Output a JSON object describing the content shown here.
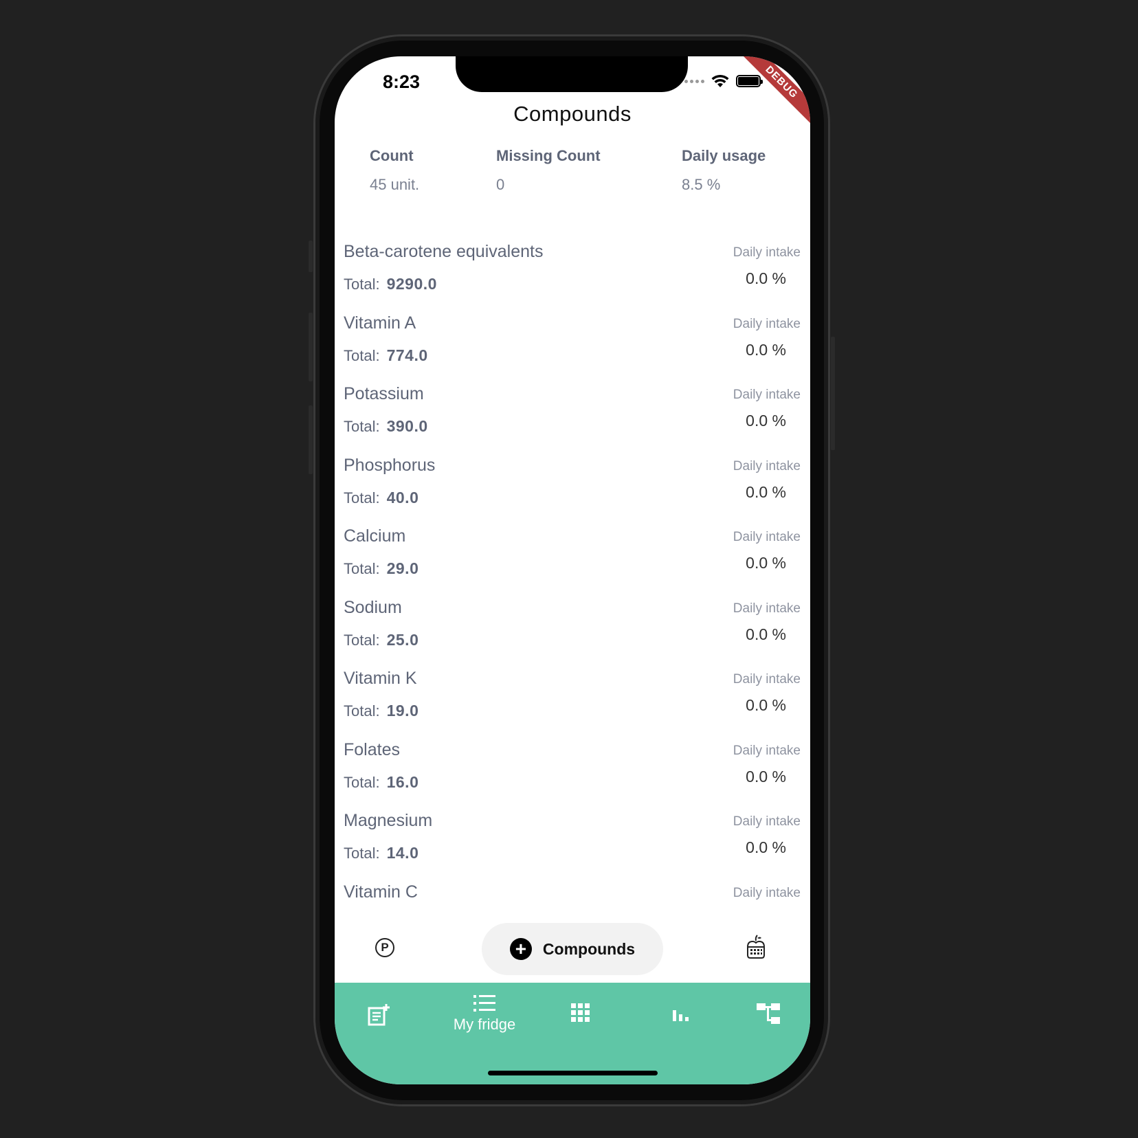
{
  "status_bar": {
    "time": "8:23"
  },
  "debug_banner": "DEBUG",
  "header": {
    "title": "Compounds"
  },
  "stats": [
    {
      "label": "Count",
      "value": "45 unit."
    },
    {
      "label": "Missing Count",
      "value": "0"
    },
    {
      "label": "Daily usage",
      "value": "8.5 %"
    }
  ],
  "list": {
    "total_prefix": "Total:",
    "daily_intake_label": "Daily intake",
    "items": [
      {
        "name": "Beta-carotene equivalents",
        "total": "9290.0",
        "daily_intake": "0.0 %"
      },
      {
        "name": "Vitamin A",
        "total": "774.0",
        "daily_intake": "0.0 %"
      },
      {
        "name": "Potassium",
        "total": "390.0",
        "daily_intake": "0.0 %"
      },
      {
        "name": "Phosphorus",
        "total": "40.0",
        "daily_intake": "0.0 %"
      },
      {
        "name": "Calcium",
        "total": "29.0",
        "daily_intake": "0.0 %"
      },
      {
        "name": "Sodium",
        "total": "25.0",
        "daily_intake": "0.0 %"
      },
      {
        "name": "Vitamin K",
        "total": "19.0",
        "daily_intake": "0.0 %"
      },
      {
        "name": "Folates",
        "total": "16.0",
        "daily_intake": "0.0 %"
      },
      {
        "name": "Magnesium",
        "total": "14.0",
        "daily_intake": "0.0 %"
      },
      {
        "name": "Vitamin C",
        "total": "",
        "daily_intake": ""
      }
    ]
  },
  "action_bar": {
    "left_icon": "p-circle-icon",
    "center_button": {
      "icon": "plus-circle-icon",
      "label": "Compounds"
    },
    "right_icon": "fridge-apple-icon"
  },
  "tab_bar": {
    "background": "#5fc6a6",
    "tabs": [
      {
        "icon": "note-add-icon",
        "label": ""
      },
      {
        "icon": "list-icon",
        "label": "My fridge"
      },
      {
        "icon": "grid-icon",
        "label": ""
      },
      {
        "icon": "bar-chart-icon",
        "label": ""
      },
      {
        "icon": "tree-icon",
        "label": ""
      }
    ]
  }
}
